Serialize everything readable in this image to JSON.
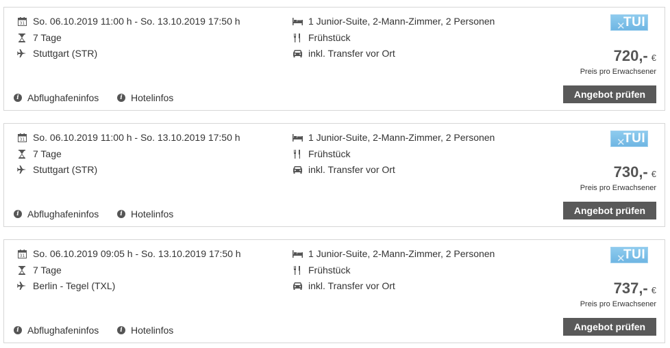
{
  "offers": [
    {
      "dates": "So. 06.10.2019 11:00 h - So. 13.10.2019 17:50 h",
      "duration": "7 Tage",
      "airport": "Stuttgart (STR)",
      "room": "1 Junior-Suite, 2-Mann-Zimmer, 2 Personen",
      "board": "Frühstück",
      "transfer": "inkl. Transfer vor Ort",
      "operator": "TUI",
      "price": "720,-",
      "currency": "€",
      "price_note": "Preis pro Erwachsener",
      "cta": "Angebot prüfen",
      "airport_info": "Abflughafeninfos",
      "hotel_info": "Hotelinfos"
    },
    {
      "dates": "So. 06.10.2019 11:00 h - So. 13.10.2019 17:50 h",
      "duration": "7 Tage",
      "airport": "Stuttgart (STR)",
      "room": "1 Junior-Suite, 2-Mann-Zimmer, 2 Personen",
      "board": "Frühstück",
      "transfer": "inkl. Transfer vor Ort",
      "operator": "TUI",
      "price": "730,-",
      "currency": "€",
      "price_note": "Preis pro Erwachsener",
      "cta": "Angebot prüfen",
      "airport_info": "Abflughafeninfos",
      "hotel_info": "Hotelinfos"
    },
    {
      "dates": "So. 06.10.2019 09:05 h - So. 13.10.2019 17:50 h",
      "duration": "7 Tage",
      "airport": "Berlin - Tegel (TXL)",
      "room": "1 Junior-Suite, 2-Mann-Zimmer, 2 Personen",
      "board": "Frühstück",
      "transfer": "inkl. Transfer vor Ort",
      "operator": "TUI",
      "price": "737,-",
      "currency": "€",
      "price_note": "Preis pro Erwachsener",
      "cta": "Angebot prüfen",
      "airport_info": "Abflughafeninfos",
      "hotel_info": "Hotelinfos"
    }
  ],
  "icons": {
    "dates": "calendar-icon",
    "duration": "hourglass-icon",
    "airport": "plane-icon",
    "room": "bed-icon",
    "board": "cutlery-icon",
    "transfer": "car-icon",
    "info": "info-icon"
  },
  "colors": {
    "button_bg": "#595959",
    "logo_bg": "#7abde6",
    "border": "#d6d6d6"
  }
}
